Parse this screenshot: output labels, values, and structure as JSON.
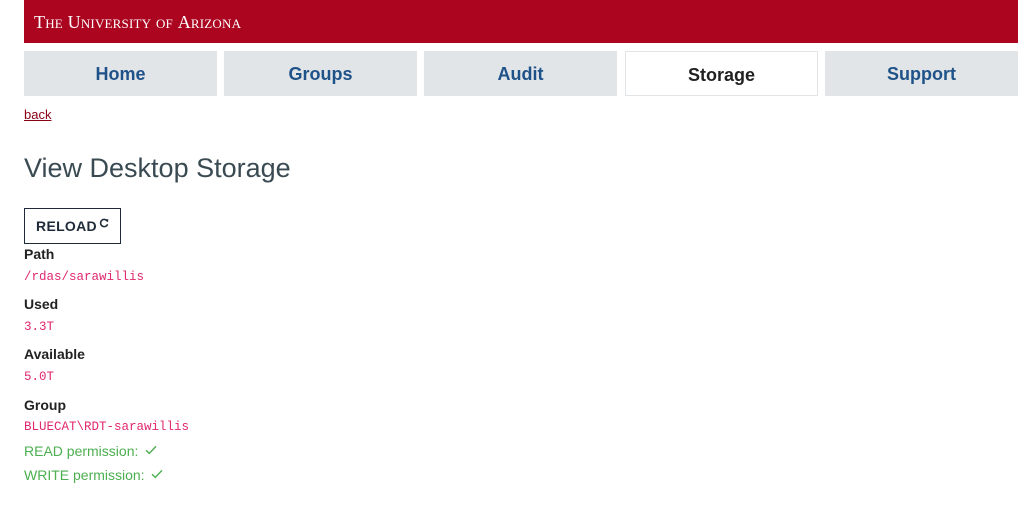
{
  "header": {
    "wordmark_the": "The",
    "wordmark_university": "University",
    "wordmark_of": "of",
    "wordmark_arizona": "Arizona",
    "brand_color": "#ab0520"
  },
  "nav": {
    "tabs": [
      {
        "label": "Home",
        "active": false
      },
      {
        "label": "Groups",
        "active": false
      },
      {
        "label": "Audit",
        "active": false
      },
      {
        "label": "Storage",
        "active": true
      },
      {
        "label": "Support",
        "active": false
      }
    ]
  },
  "back_link": "back",
  "page_title": "View Desktop Storage",
  "reload_button": {
    "label": "RELOAD",
    "icon": "refresh-icon"
  },
  "fields": {
    "path": {
      "label": "Path",
      "value": "/rdas/sarawillis"
    },
    "used": {
      "label": "Used",
      "value": "3.3T"
    },
    "available": {
      "label": "Available",
      "value": "5.0T"
    },
    "group": {
      "label": "Group",
      "value": "BLUECAT\\RDT-sarawillis"
    }
  },
  "permissions": {
    "read": {
      "label": "READ permission:",
      "icon": "checkmark-icon"
    },
    "write": {
      "label": "WRITE permission:",
      "icon": "checkmark-icon"
    }
  },
  "colors": {
    "tab_text": "#1e5288",
    "value_text": "#e0286e",
    "permission_text": "#4caf50"
  }
}
